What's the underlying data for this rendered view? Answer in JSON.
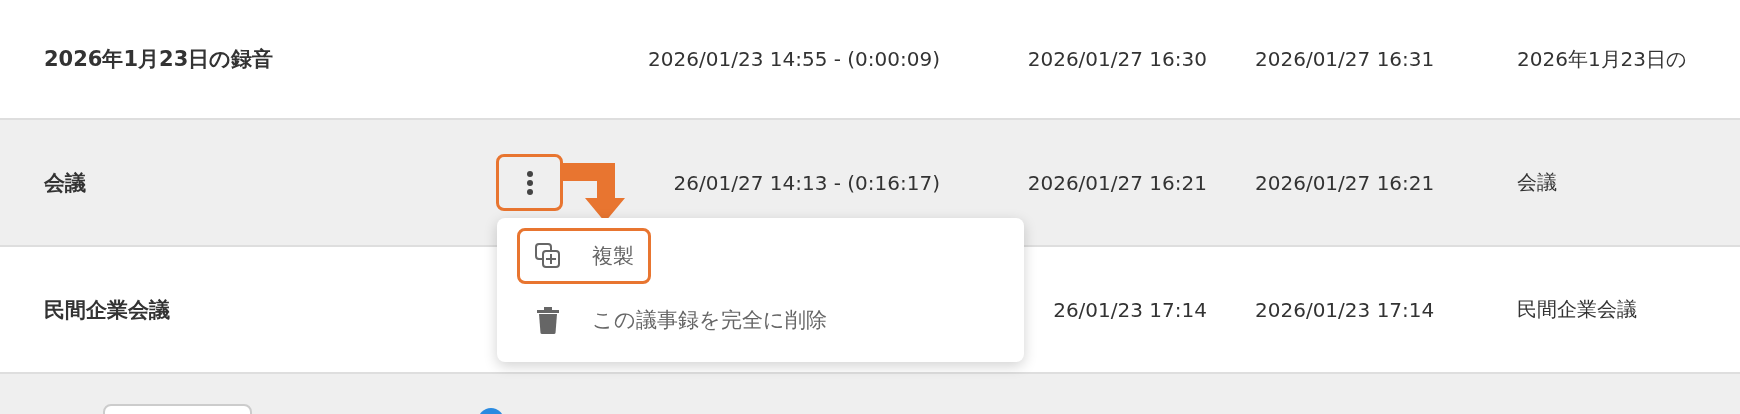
{
  "rows": [
    {
      "title": "2026年1月23日の録音",
      "hovered": false,
      "highlighted": false,
      "cells": [
        "2026/01/23 14:55 - (0:00:09)",
        "2026/01/27 16:30",
        "2026/01/27 16:31",
        "2026年1月23日の"
      ]
    },
    {
      "title": "会議",
      "hovered": true,
      "highlighted": true,
      "cells": [
        "26/01/27 14:13 - (0:16:17)",
        "2026/01/27 16:21",
        "2026/01/27 16:21",
        "会議"
      ]
    },
    {
      "title": "民間企業会議",
      "hovered": false,
      "highlighted": false,
      "cells": [
        null,
        "26/01/23 17:14",
        "2026/01/23 17:14",
        "民間企業会議"
      ]
    }
  ],
  "menu": {
    "items": [
      {
        "kind": "copy",
        "label": "複製",
        "highlighted": true
      },
      {
        "kind": "delete",
        "label": "この議事録を完全に削除",
        "highlighted": false
      }
    ]
  }
}
